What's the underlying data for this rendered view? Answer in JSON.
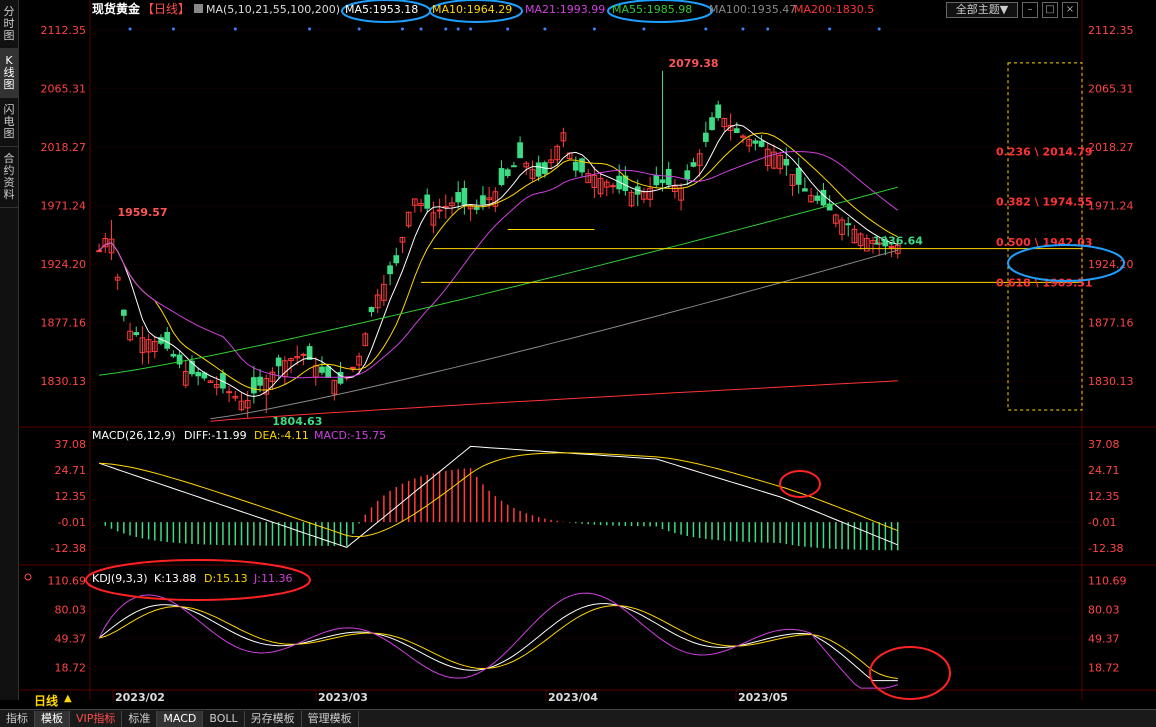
{
  "left_rail": [
    {
      "label": "分时图",
      "active": false
    },
    {
      "label": "K线图",
      "active": true
    },
    {
      "label": "闪电图",
      "active": false
    },
    {
      "label": "合约资料",
      "active": false
    }
  ],
  "header": {
    "symbol": "现货黄金",
    "period_tag": "【日线】",
    "ma_params": "MA(5,10,21,55,100,200)",
    "ma_values": [
      {
        "label": "MA5:1953.18",
        "color": "#ffffff"
      },
      {
        "label": "MA10:1964.29",
        "color": "#ffd700"
      },
      {
        "label": "MA21:1993.99",
        "color": "#d040e0"
      },
      {
        "label": "MA55:1985.98",
        "color": "#33cc33"
      },
      {
        "label": "MA100:1935.47",
        "color": "#888888"
      },
      {
        "label": "MA200:1830.5",
        "color": "#ff3333"
      }
    ],
    "theme_button": "全部主题▼"
  },
  "colors": {
    "up": "#ff3b3b",
    "down": "#3ddc84",
    "axis": "#ff4444",
    "grid": "#3a0000"
  },
  "chart_data": [
    {
      "type": "candlestick",
      "title": "现货黄金 日线",
      "x_labels": [
        "2023/02",
        "2023/03",
        "2023/04",
        "2023/05"
      ],
      "y_ticks": [
        2112.35,
        2065.31,
        2018.27,
        1971.24,
        1924.2,
        1877.16,
        1830.13
      ],
      "ylim": [
        1795,
        2125
      ],
      "annotations": [
        {
          "label": "1959.57",
          "value": 1959.57,
          "bar": 2
        },
        {
          "label": "1804.63",
          "value": 1804.63,
          "bar": 27
        },
        {
          "label": "2079.38",
          "value": 2079.38,
          "bar": 91
        },
        {
          "label": "1936.64",
          "value": 1936.64,
          "bar": 124
        }
      ],
      "fibonacci": [
        {
          "label": "0.236 \\ 2014.79",
          "value": 2014.79
        },
        {
          "label": "0.382 \\ 1974.55",
          "value": 1974.55
        },
        {
          "label": "0.500 \\ 1942.03",
          "value": 1942.03
        },
        {
          "label": "0.618 \\ 1909.51",
          "value": 1909.51
        }
      ],
      "moving_averages": [
        {
          "name": "MA200",
          "color": "#ff3333",
          "from": 1798,
          "to": 1830.5
        },
        {
          "name": "MA100",
          "color": "#888888",
          "from": 1800,
          "to": 1935.47
        },
        {
          "name": "MA55",
          "color": "#33cc33",
          "from": 1835,
          "to": 1985.98
        }
      ]
    },
    {
      "type": "bar",
      "title": "MACD(26,12,9)",
      "labels": {
        "params": "MACD(26,12,9)",
        "diff": "DIFF:-11.99",
        "dea": "DEA:-4.11",
        "macd": "MACD:-15.75"
      },
      "y_ticks": [
        37.08,
        24.71,
        12.35,
        -0.01,
        -12.38
      ],
      "ylim": [
        -18,
        40
      ]
    },
    {
      "type": "line",
      "title": "KDJ(9,3,3)",
      "labels": {
        "params": "KDJ(9,3,3)",
        "k": "K:13.88",
        "d": "D:15.13",
        "j": "J:11.36"
      },
      "y_ticks": [
        110.69,
        80.03,
        49.37,
        18.72
      ],
      "ylim": [
        -5,
        122
      ]
    }
  ],
  "bottom_tabs": [
    {
      "label": "指标",
      "active": false
    },
    {
      "label": "模板",
      "active": true
    },
    {
      "label": "VIP指标",
      "active": false,
      "vip": true
    },
    {
      "label": "标准",
      "active": false
    },
    {
      "label": "MACD",
      "active": true
    },
    {
      "label": "BOLL",
      "active": false
    },
    {
      "label": "另存模板",
      "active": false
    },
    {
      "label": "管理模板",
      "active": false
    }
  ],
  "period_label": "日线"
}
